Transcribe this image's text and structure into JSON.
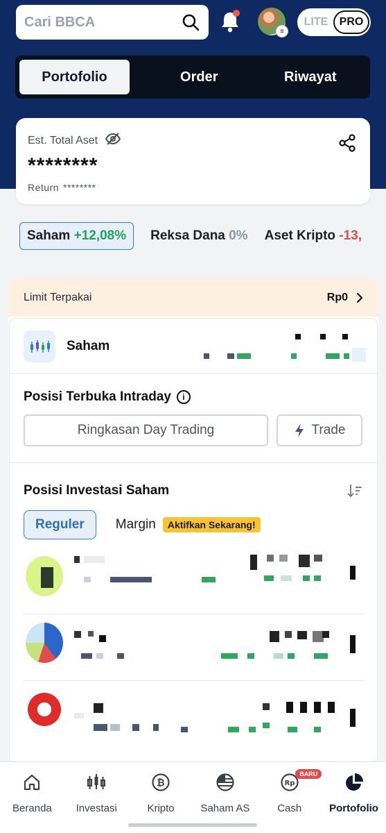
{
  "header": {
    "search_placeholder": "Cari BBCA",
    "mode_lite": "LITE",
    "mode_pro": "PRO"
  },
  "tabs": [
    {
      "label": "Portofolio",
      "active": true
    },
    {
      "label": "Order",
      "active": false
    },
    {
      "label": "Riwayat",
      "active": false
    }
  ],
  "asset_card": {
    "label": "Est. Total Aset",
    "value": "********",
    "return_label": "Return",
    "return_value": "********"
  },
  "chips": [
    {
      "name": "Saham",
      "change": "+12,08%",
      "color": "green",
      "active": true
    },
    {
      "name": "Reksa Dana",
      "change": "0%",
      "color": "grey",
      "active": false
    },
    {
      "name": "Aset Kripto",
      "change": "-13,",
      "color": "red",
      "active": false
    }
  ],
  "limit": {
    "label": "Limit Terpakai",
    "value": "Rp0"
  },
  "saham_row": {
    "label": "Saham"
  },
  "intraday": {
    "title": "Posisi Terbuka Intraday",
    "day_trading_button": "Ringkasan Day Trading",
    "trade_button": "Trade"
  },
  "posisi": {
    "title": "Posisi Investasi Saham",
    "reguler": "Reguler",
    "margin": "Margin",
    "badge": "Aktifkan Sekarang!"
  },
  "bottom_nav": [
    {
      "label": "Beranda",
      "icon": "home-icon",
      "active": false
    },
    {
      "label": "Investasi",
      "icon": "candlestick-icon",
      "active": false
    },
    {
      "label": "Kripto",
      "icon": "bitcoin-icon",
      "active": false
    },
    {
      "label": "Saham AS",
      "icon": "us-flag-icon",
      "active": false
    },
    {
      "label": "Cash",
      "icon": "rupiah-icon",
      "active": false,
      "badge": "BARU"
    },
    {
      "label": "Portofolio",
      "icon": "pie-chart-icon",
      "active": true
    }
  ],
  "colors": {
    "navy": "#0f2a63",
    "accent_blue": "#3a7cc5",
    "green": "#22a35a",
    "red": "#e04d4d",
    "badge_yellow": "#f8c235"
  }
}
